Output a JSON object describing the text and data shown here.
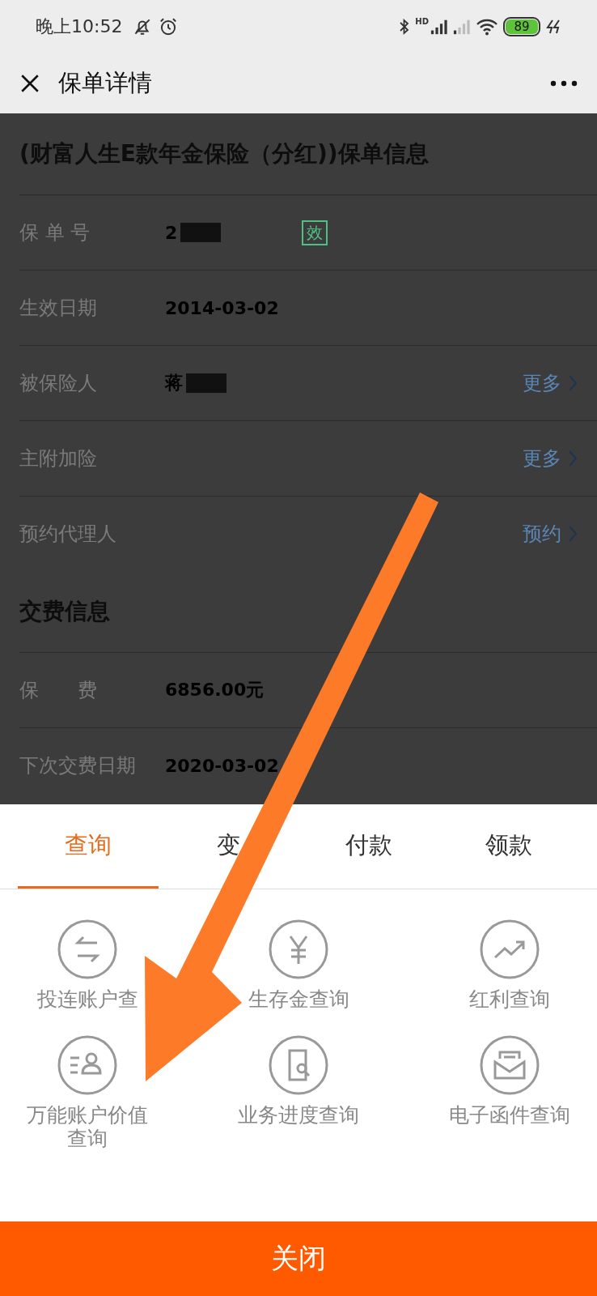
{
  "status_bar": {
    "time": "晚上10:52",
    "network_label": "HD",
    "battery": "89"
  },
  "header": {
    "title": "保单详情"
  },
  "policy_section": {
    "title": "(财富人生E款年金保险（分红))保单信息",
    "rows": [
      {
        "label": "保 单 号",
        "value": "2",
        "redacted": true,
        "badge": "效"
      },
      {
        "label": "生效日期",
        "value": "2014-03-02"
      },
      {
        "label": "被保险人",
        "value": "蒋",
        "redacted": true,
        "link": "更多"
      },
      {
        "label": "主附加险",
        "link": "更多"
      },
      {
        "label": "预约代理人",
        "link": "预约"
      }
    ]
  },
  "payment_section": {
    "title": "交费信息",
    "rows": [
      {
        "label": "保　　费",
        "value": "6856.00元"
      },
      {
        "label": "下次交费日期",
        "value": "2020-03-02"
      }
    ]
  },
  "sheet": {
    "tabs": [
      {
        "label": "查询",
        "selected": true
      },
      {
        "label": "变",
        "selected": false
      },
      {
        "label": "付款",
        "selected": false
      },
      {
        "label": "领款",
        "selected": false
      }
    ],
    "actions": [
      {
        "label": "投连账户查"
      },
      {
        "label": "生存金查询"
      },
      {
        "label": "红利查询"
      },
      {
        "label": "万能账户价值查询"
      },
      {
        "label": "业务进度查询"
      },
      {
        "label": "电子函件查询"
      }
    ],
    "close_button": "关闭"
  }
}
